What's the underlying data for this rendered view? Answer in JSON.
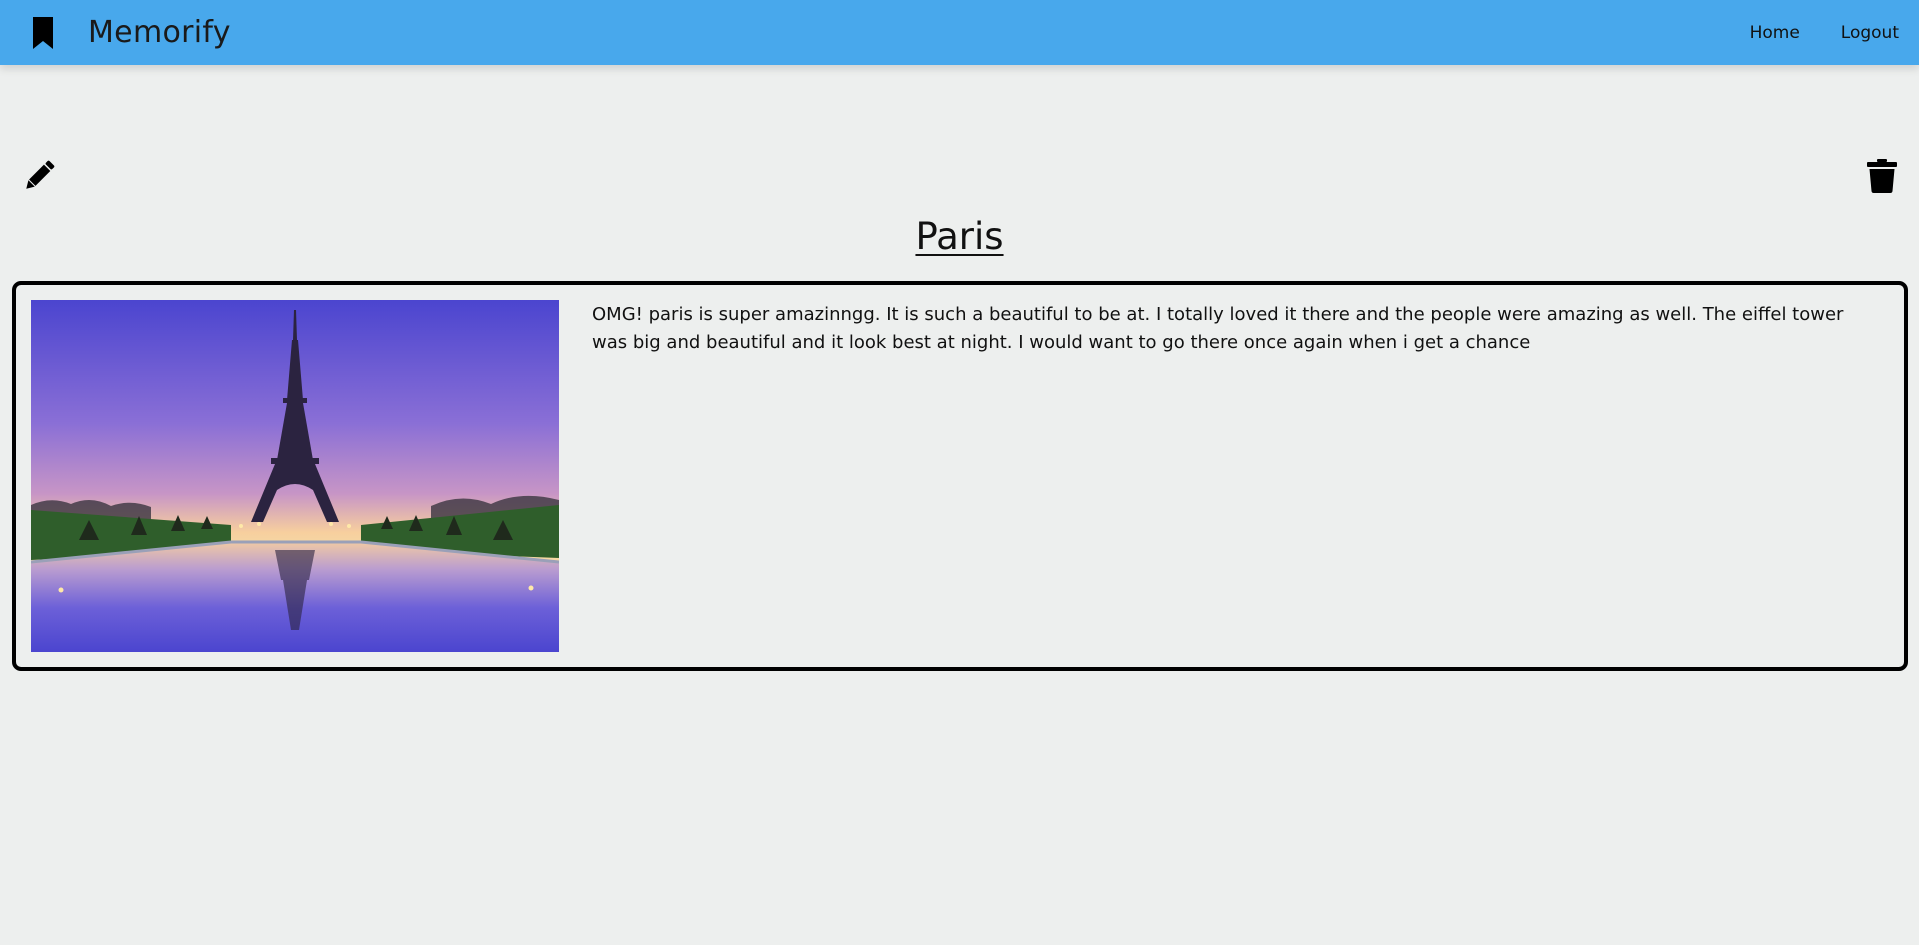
{
  "navbar": {
    "brand_icon": "bookmark-icon",
    "brand_name": "Memorify",
    "links": [
      {
        "label": "Home"
      },
      {
        "label": "Logout"
      }
    ],
    "background_color": "#48a8ec"
  },
  "actions": {
    "edit_icon": "pencil-icon",
    "delete_icon": "trash-icon"
  },
  "memory": {
    "title": "Paris",
    "image_icon": "eiffel-tower-photo",
    "description": "OMG! paris is super amazinngg. It is such a beautiful to be at. I totally loved it there and the people were amazing as well. The eiffel tower was big and beautiful and it look best at night. I would want to go there once again when i get a chance"
  }
}
